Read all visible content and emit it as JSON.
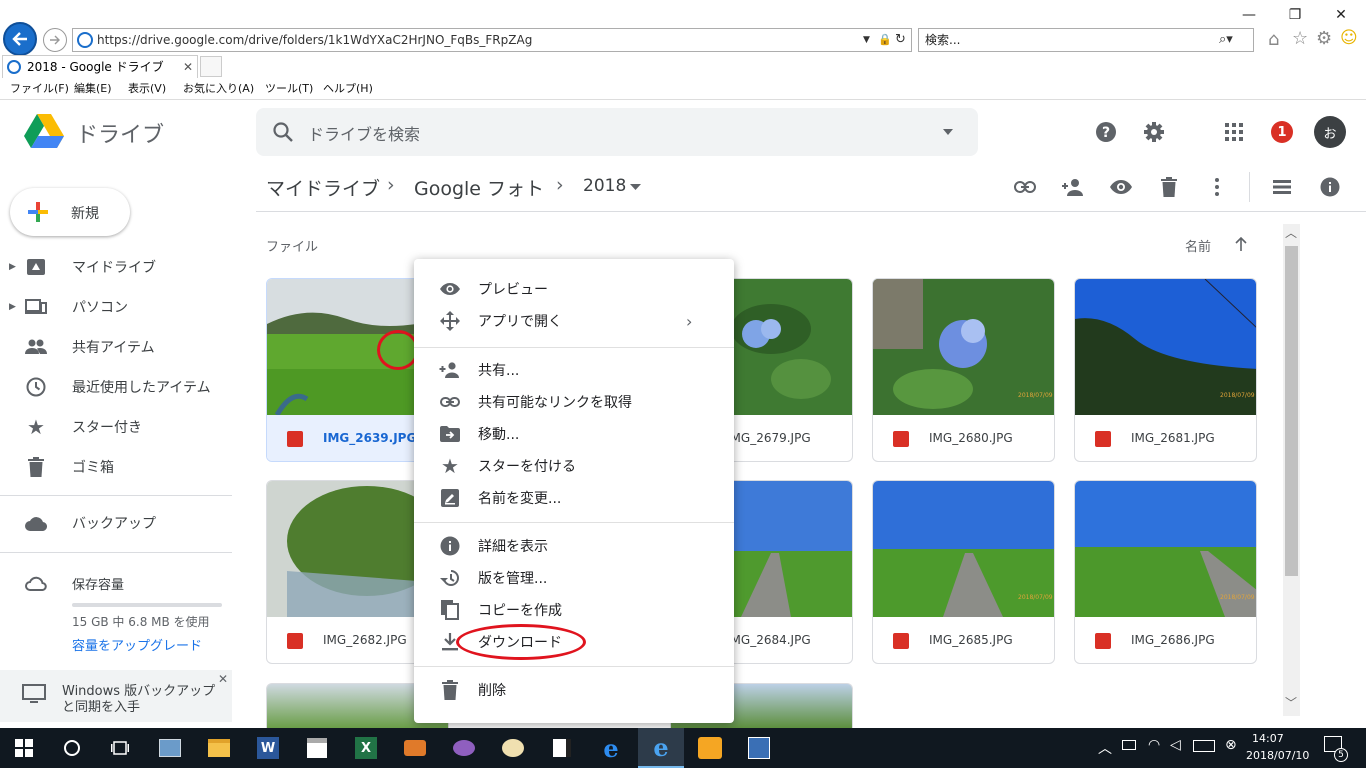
{
  "browser": {
    "url": "https://drive.google.com/drive/folders/1k1WdYXaC2HrJNO_FqBs_FRpZAg",
    "search_placeholder": "検索...",
    "tab_title": "2018 - Google ドライブ",
    "menu": [
      "ファイル(F)",
      "編集(E)",
      "表示(V)",
      "お気に入り(A)",
      "ツール(T)",
      "ヘルプ(H)"
    ]
  },
  "drive": {
    "product_name": "ドライブ",
    "search_placeholder": "ドライブを検索",
    "notification_count": "1",
    "avatar_letter": "お",
    "new_button": "新規",
    "breadcrumb": [
      "マイドライブ",
      "Google フォト",
      "2018"
    ],
    "section_label": "ファイル",
    "sort_label": "名前",
    "nav": [
      {
        "label": "マイドライブ"
      },
      {
        "label": "パソコン"
      },
      {
        "label": "共有アイテム"
      },
      {
        "label": "最近使用したアイテム"
      },
      {
        "label": "スター付き"
      },
      {
        "label": "ゴミ箱"
      },
      {
        "label": "バックアップ"
      },
      {
        "label": "保存容量"
      }
    ],
    "storage_usage": "15 GB 中 6.8 MB を使用",
    "storage_upgrade": "容量をアップグレード",
    "backup_promo_line1": "Windows 版バックアップ",
    "backup_promo_line2": "と同期を入手",
    "files": [
      "IMG_2639.JPG",
      "IMG_2679.JPG",
      "IMG_2680.JPG",
      "IMG_2681.JPG",
      "IMG_2682.JPG",
      "IMG_2684.JPG",
      "IMG_2685.JPG",
      "IMG_2686.JPG"
    ],
    "context_menu": [
      "プレビュー",
      "アプリで開く",
      "共有...",
      "共有可能なリンクを取得",
      "移動...",
      "スターを付ける",
      "名前を変更...",
      "詳細を表示",
      "版を管理...",
      "コピーを作成",
      "ダウンロード",
      "削除"
    ],
    "photo_date": "2018/07/09"
  },
  "taskbar": {
    "time": "14:07",
    "date": "2018/07/10",
    "notification_count": "5"
  },
  "colors": {
    "accent_blue": "#1a73e8",
    "annotation_red": "#e0141e",
    "badge_red": "#d93025"
  }
}
